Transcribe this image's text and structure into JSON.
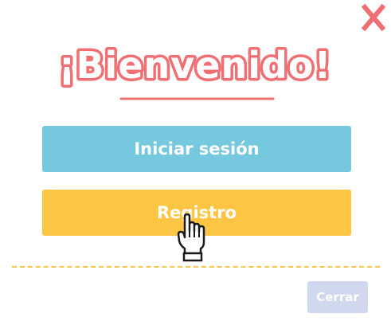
{
  "dialog": {
    "title": "¡Bienvenido!",
    "close_icon": "close-x-icon",
    "colors": {
      "title": "#ffffff",
      "title_outline": "#ef6f72",
      "underline": "#ef6f72",
      "close_x": "#ef6f72",
      "login_button": "#76c8de",
      "register_button": "#fcc644",
      "divider": "#f5c543",
      "close_button": "#cfd8ef"
    }
  },
  "buttons": {
    "login_label": "Iniciar sesión",
    "register_label": "Registro",
    "close_label": "Cerrar"
  },
  "cursor": {
    "icon": "hand-pointer-icon"
  }
}
